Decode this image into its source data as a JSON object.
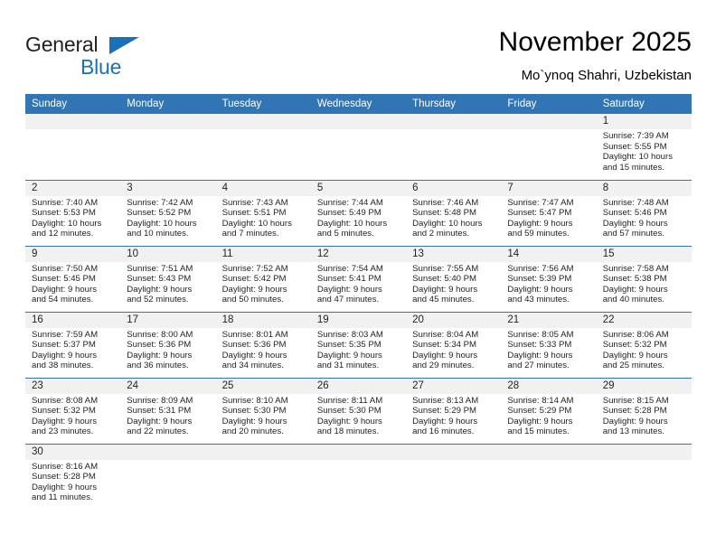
{
  "brand": {
    "name_part1": "General",
    "name_part2": "Blue",
    "triangle_color": "#1b71b8"
  },
  "header": {
    "title": "November 2025",
    "subtitle": "Mo`ynoq Shahri, Uzbekistan"
  },
  "theme": {
    "header_blue": "#3275b4",
    "daynum_band": "#f1f1f1",
    "text": "#231f20"
  },
  "weekdays": [
    "Sunday",
    "Monday",
    "Tuesday",
    "Wednesday",
    "Thursday",
    "Friday",
    "Saturday"
  ],
  "weeks": [
    [
      {
        "day": "",
        "lines": []
      },
      {
        "day": "",
        "lines": []
      },
      {
        "day": "",
        "lines": []
      },
      {
        "day": "",
        "lines": []
      },
      {
        "day": "",
        "lines": []
      },
      {
        "day": "",
        "lines": []
      },
      {
        "day": "1",
        "lines": [
          "Sunrise: 7:39 AM",
          "Sunset: 5:55 PM",
          "Daylight: 10 hours",
          "and 15 minutes."
        ]
      }
    ],
    [
      {
        "day": "2",
        "lines": [
          "Sunrise: 7:40 AM",
          "Sunset: 5:53 PM",
          "Daylight: 10 hours",
          "and 12 minutes."
        ]
      },
      {
        "day": "3",
        "lines": [
          "Sunrise: 7:42 AM",
          "Sunset: 5:52 PM",
          "Daylight: 10 hours",
          "and 10 minutes."
        ]
      },
      {
        "day": "4",
        "lines": [
          "Sunrise: 7:43 AM",
          "Sunset: 5:51 PM",
          "Daylight: 10 hours",
          "and 7 minutes."
        ]
      },
      {
        "day": "5",
        "lines": [
          "Sunrise: 7:44 AM",
          "Sunset: 5:49 PM",
          "Daylight: 10 hours",
          "and 5 minutes."
        ]
      },
      {
        "day": "6",
        "lines": [
          "Sunrise: 7:46 AM",
          "Sunset: 5:48 PM",
          "Daylight: 10 hours",
          "and 2 minutes."
        ]
      },
      {
        "day": "7",
        "lines": [
          "Sunrise: 7:47 AM",
          "Sunset: 5:47 PM",
          "Daylight: 9 hours",
          "and 59 minutes."
        ]
      },
      {
        "day": "8",
        "lines": [
          "Sunrise: 7:48 AM",
          "Sunset: 5:46 PM",
          "Daylight: 9 hours",
          "and 57 minutes."
        ]
      }
    ],
    [
      {
        "day": "9",
        "lines": [
          "Sunrise: 7:50 AM",
          "Sunset: 5:45 PM",
          "Daylight: 9 hours",
          "and 54 minutes."
        ]
      },
      {
        "day": "10",
        "lines": [
          "Sunrise: 7:51 AM",
          "Sunset: 5:43 PM",
          "Daylight: 9 hours",
          "and 52 minutes."
        ]
      },
      {
        "day": "11",
        "lines": [
          "Sunrise: 7:52 AM",
          "Sunset: 5:42 PM",
          "Daylight: 9 hours",
          "and 50 minutes."
        ]
      },
      {
        "day": "12",
        "lines": [
          "Sunrise: 7:54 AM",
          "Sunset: 5:41 PM",
          "Daylight: 9 hours",
          "and 47 minutes."
        ]
      },
      {
        "day": "13",
        "lines": [
          "Sunrise: 7:55 AM",
          "Sunset: 5:40 PM",
          "Daylight: 9 hours",
          "and 45 minutes."
        ]
      },
      {
        "day": "14",
        "lines": [
          "Sunrise: 7:56 AM",
          "Sunset: 5:39 PM",
          "Daylight: 9 hours",
          "and 43 minutes."
        ]
      },
      {
        "day": "15",
        "lines": [
          "Sunrise: 7:58 AM",
          "Sunset: 5:38 PM",
          "Daylight: 9 hours",
          "and 40 minutes."
        ]
      }
    ],
    [
      {
        "day": "16",
        "lines": [
          "Sunrise: 7:59 AM",
          "Sunset: 5:37 PM",
          "Daylight: 9 hours",
          "and 38 minutes."
        ]
      },
      {
        "day": "17",
        "lines": [
          "Sunrise: 8:00 AM",
          "Sunset: 5:36 PM",
          "Daylight: 9 hours",
          "and 36 minutes."
        ]
      },
      {
        "day": "18",
        "lines": [
          "Sunrise: 8:01 AM",
          "Sunset: 5:36 PM",
          "Daylight: 9 hours",
          "and 34 minutes."
        ]
      },
      {
        "day": "19",
        "lines": [
          "Sunrise: 8:03 AM",
          "Sunset: 5:35 PM",
          "Daylight: 9 hours",
          "and 31 minutes."
        ]
      },
      {
        "day": "20",
        "lines": [
          "Sunrise: 8:04 AM",
          "Sunset: 5:34 PM",
          "Daylight: 9 hours",
          "and 29 minutes."
        ]
      },
      {
        "day": "21",
        "lines": [
          "Sunrise: 8:05 AM",
          "Sunset: 5:33 PM",
          "Daylight: 9 hours",
          "and 27 minutes."
        ]
      },
      {
        "day": "22",
        "lines": [
          "Sunrise: 8:06 AM",
          "Sunset: 5:32 PM",
          "Daylight: 9 hours",
          "and 25 minutes."
        ]
      }
    ],
    [
      {
        "day": "23",
        "lines": [
          "Sunrise: 8:08 AM",
          "Sunset: 5:32 PM",
          "Daylight: 9 hours",
          "and 23 minutes."
        ]
      },
      {
        "day": "24",
        "lines": [
          "Sunrise: 8:09 AM",
          "Sunset: 5:31 PM",
          "Daylight: 9 hours",
          "and 22 minutes."
        ]
      },
      {
        "day": "25",
        "lines": [
          "Sunrise: 8:10 AM",
          "Sunset: 5:30 PM",
          "Daylight: 9 hours",
          "and 20 minutes."
        ]
      },
      {
        "day": "26",
        "lines": [
          "Sunrise: 8:11 AM",
          "Sunset: 5:30 PM",
          "Daylight: 9 hours",
          "and 18 minutes."
        ]
      },
      {
        "day": "27",
        "lines": [
          "Sunrise: 8:13 AM",
          "Sunset: 5:29 PM",
          "Daylight: 9 hours",
          "and 16 minutes."
        ]
      },
      {
        "day": "28",
        "lines": [
          "Sunrise: 8:14 AM",
          "Sunset: 5:29 PM",
          "Daylight: 9 hours",
          "and 15 minutes."
        ]
      },
      {
        "day": "29",
        "lines": [
          "Sunrise: 8:15 AM",
          "Sunset: 5:28 PM",
          "Daylight: 9 hours",
          "and 13 minutes."
        ]
      }
    ],
    [
      {
        "day": "30",
        "lines": [
          "Sunrise: 8:16 AM",
          "Sunset: 5:28 PM",
          "Daylight: 9 hours",
          "and 11 minutes."
        ]
      },
      {
        "day": "",
        "lines": []
      },
      {
        "day": "",
        "lines": []
      },
      {
        "day": "",
        "lines": []
      },
      {
        "day": "",
        "lines": []
      },
      {
        "day": "",
        "lines": []
      },
      {
        "day": "",
        "lines": []
      }
    ]
  ]
}
